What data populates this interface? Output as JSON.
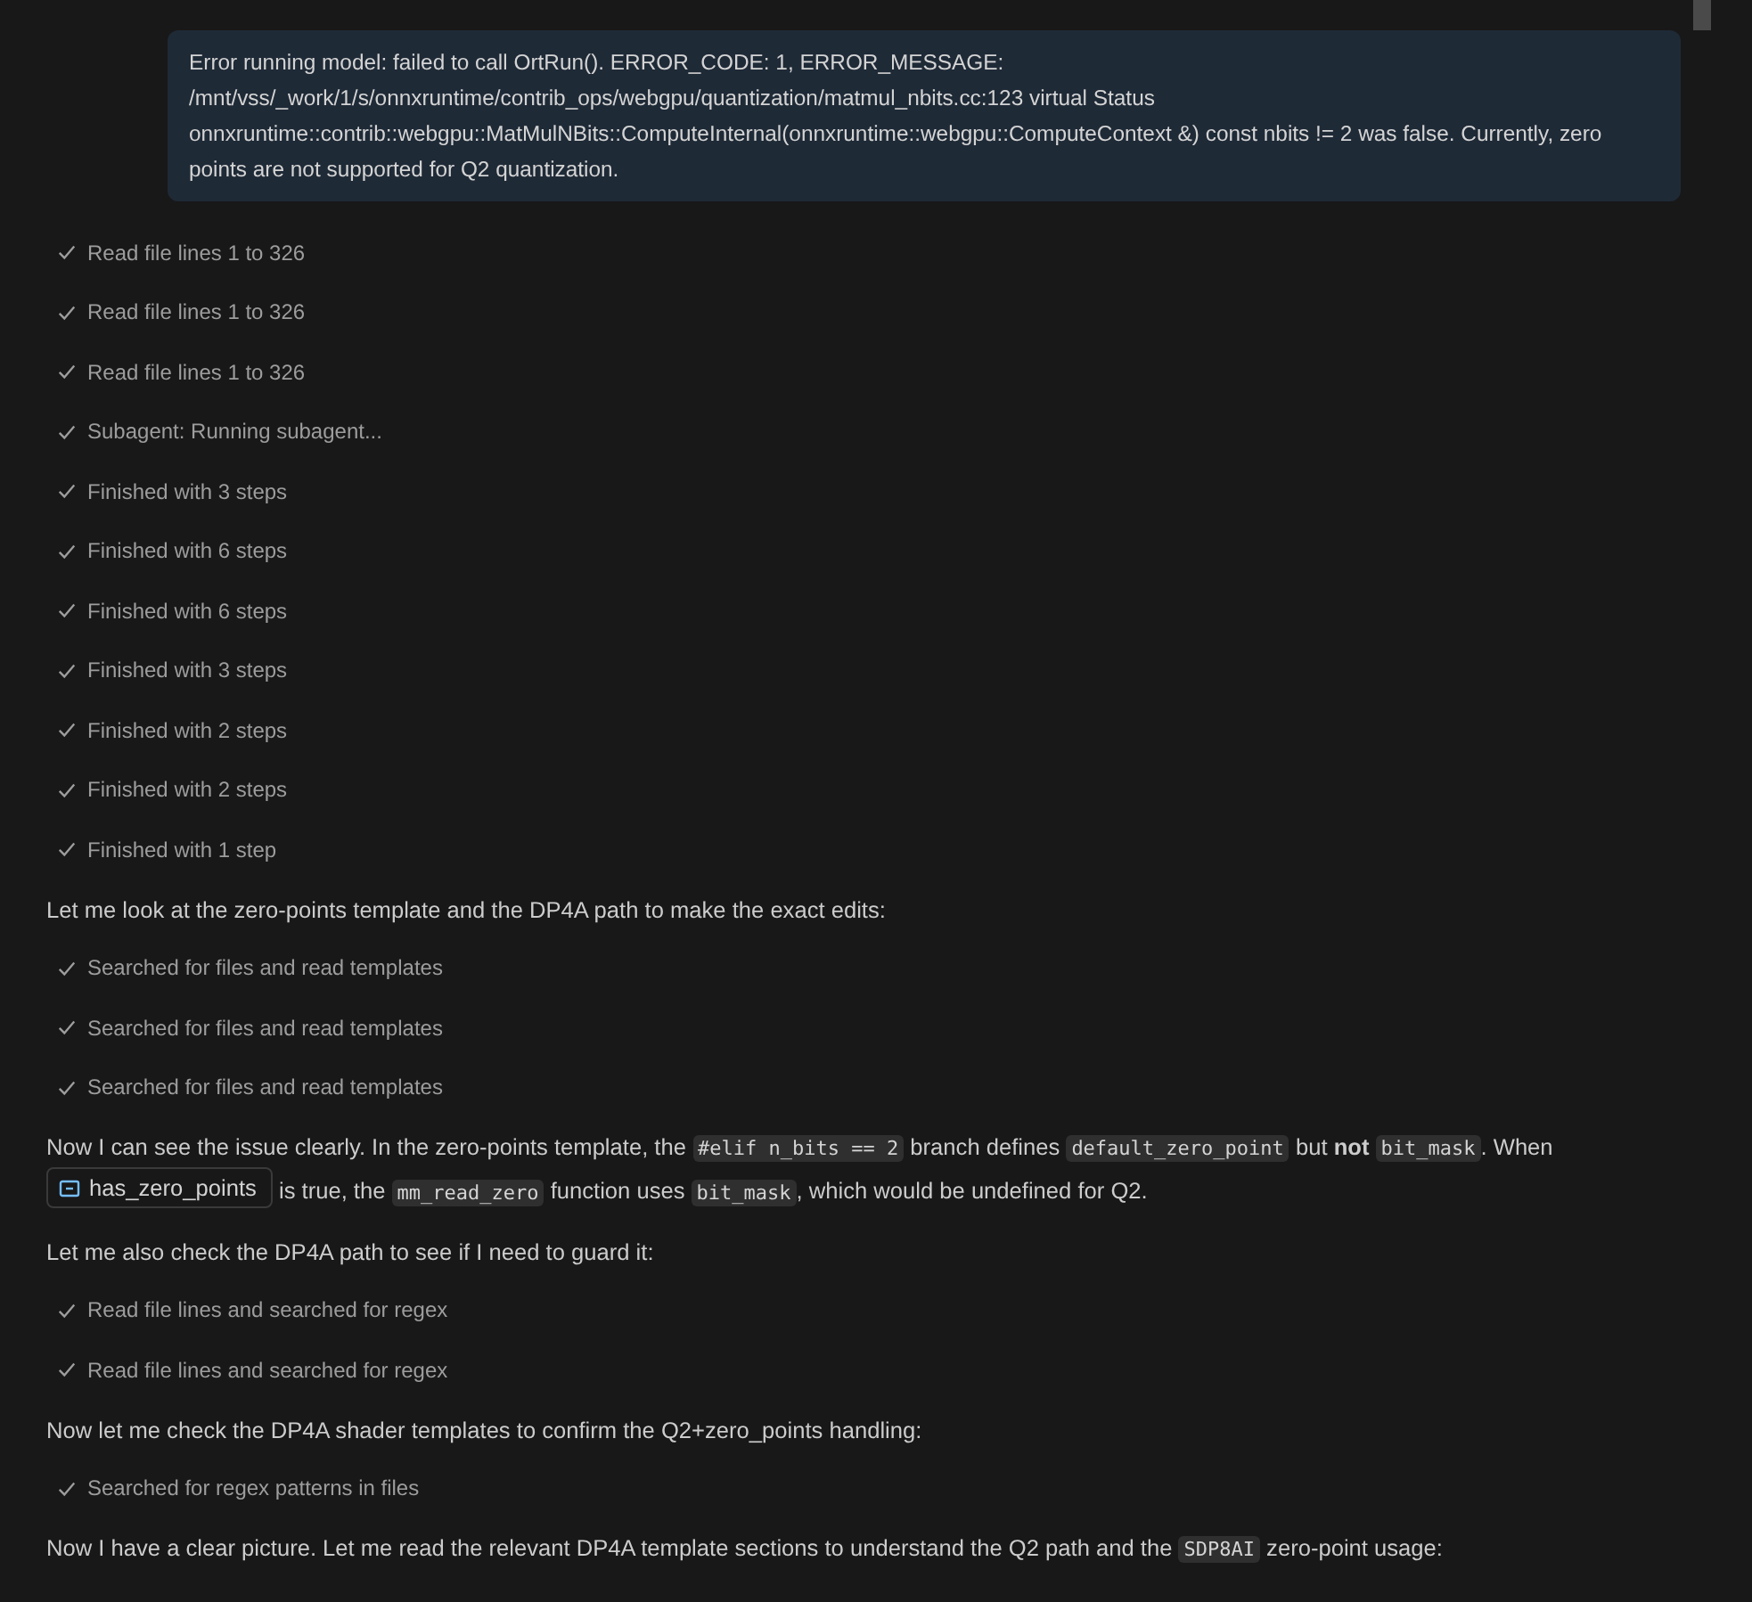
{
  "user_message": "Error running model: failed to call OrtRun(). ERROR_CODE: 1, ERROR_MESSAGE: /mnt/vss/_work/1/s/onnxruntime/contrib_ops/webgpu/quantization/matmul_nbits.cc:123 virtual Status onnxruntime::contrib::webgpu::MatMulNBits::ComputeInternal(onnxruntime::webgpu::ComputeContext &) const nbits != 2 was false. Currently, zero points are not supported for Q2 quantization.",
  "transcript": [
    {
      "kind": "step",
      "text": "Read file lines 1 to 326"
    },
    {
      "kind": "step",
      "text": "Read file lines 1 to 326"
    },
    {
      "kind": "step",
      "text": "Read file lines 1 to 326"
    },
    {
      "kind": "step",
      "text": "Subagent: Running subagent..."
    },
    {
      "kind": "step",
      "text": "Finished with 3 steps"
    },
    {
      "kind": "step",
      "text": "Finished with 6 steps"
    },
    {
      "kind": "step",
      "text": "Finished with 6 steps"
    },
    {
      "kind": "step",
      "text": "Finished with 3 steps"
    },
    {
      "kind": "step",
      "text": "Finished with 2 steps"
    },
    {
      "kind": "step",
      "text": "Finished with 2 steps"
    },
    {
      "kind": "step",
      "text": "Finished with 1 step"
    },
    {
      "kind": "paragraph",
      "segments": [
        {
          "kind": "text",
          "text": "Let me look at the zero-points template and the DP4A path to make the exact edits:"
        }
      ]
    },
    {
      "kind": "step",
      "text": "Searched for files and read templates"
    },
    {
      "kind": "step",
      "text": "Searched for files and read templates"
    },
    {
      "kind": "step",
      "text": "Searched for files and read templates"
    },
    {
      "kind": "paragraph",
      "segments": [
        {
          "kind": "text",
          "text": "Now I can see the issue clearly. In the zero-points template, the "
        },
        {
          "kind": "code",
          "text": "#elif n_bits == 2"
        },
        {
          "kind": "text",
          "text": " branch defines "
        },
        {
          "kind": "code",
          "text": "default_zero_point"
        },
        {
          "kind": "text",
          "text": " but "
        },
        {
          "kind": "bold",
          "text": "not "
        },
        {
          "kind": "code",
          "text": "bit_mask"
        },
        {
          "kind": "text",
          "text": ". When "
        },
        {
          "kind": "symbol",
          "text": "has_zero_points"
        },
        {
          "kind": "text",
          "text": " is true, the "
        },
        {
          "kind": "code",
          "text": "mm_read_zero"
        },
        {
          "kind": "text",
          "text": " function uses "
        },
        {
          "kind": "code",
          "text": "bit_mask"
        },
        {
          "kind": "text",
          "text": ", which would be undefined for Q2."
        }
      ]
    },
    {
      "kind": "paragraph",
      "segments": [
        {
          "kind": "text",
          "text": "Let me also check the DP4A path to see if I need to guard it:"
        }
      ]
    },
    {
      "kind": "step",
      "text": "Read file lines and searched for regex"
    },
    {
      "kind": "step",
      "text": "Read file lines and searched for regex"
    },
    {
      "kind": "paragraph",
      "segments": [
        {
          "kind": "text",
          "text": "Now let me check the DP4A shader templates to confirm the Q2+zero_points handling:"
        }
      ]
    },
    {
      "kind": "step",
      "text": "Searched for regex patterns in files"
    },
    {
      "kind": "paragraph",
      "segments": [
        {
          "kind": "text",
          "text": "Now I have a clear picture. Let me read the relevant DP4A template sections to understand the Q2 path and the "
        },
        {
          "kind": "code",
          "text": "SDP8AI"
        },
        {
          "kind": "text",
          "text": " zero-point usage:"
        }
      ]
    }
  ]
}
